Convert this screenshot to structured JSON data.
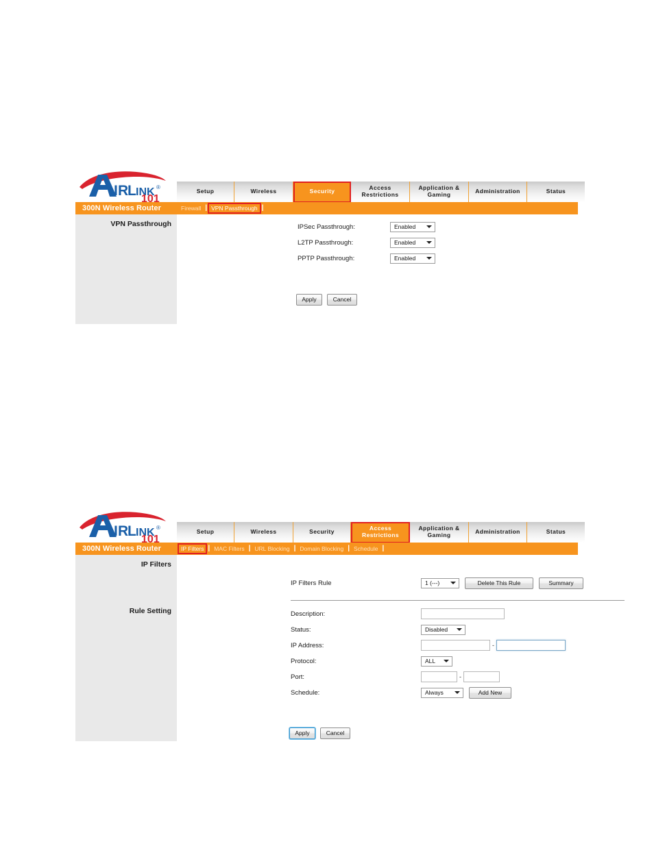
{
  "brand": {
    "name_air": "AIR",
    "name_link": "LINK",
    "registered": "®",
    "number": "101",
    "device_name": "300N Wireless Router"
  },
  "main_tabs": [
    {
      "label": "Setup",
      "lines": [
        "Setup"
      ]
    },
    {
      "label": "Wireless",
      "lines": [
        "Wireless"
      ]
    },
    {
      "label": "Security",
      "lines": [
        "Security"
      ]
    },
    {
      "label": "Access Restrictions",
      "lines": [
        "Access",
        "Restrictions"
      ]
    },
    {
      "label": "Application & Gaming",
      "lines": [
        "Application &",
        "Gaming"
      ]
    },
    {
      "label": "Administration",
      "lines": [
        "Administration"
      ]
    },
    {
      "label": "Status",
      "lines": [
        "Status"
      ]
    }
  ],
  "panel_vpn": {
    "active_main_tab": "Security",
    "subnav": [
      {
        "label": "Firewall",
        "active": false
      },
      {
        "label": "VPN Passthrough",
        "active": true
      }
    ],
    "section_title": "VPN Passthrough",
    "fields": [
      {
        "label": "IPSec Passthrough:",
        "value": "Enabled"
      },
      {
        "label": "L2TP Passthrough:",
        "value": "Enabled"
      },
      {
        "label": "PPTP Passthrough:",
        "value": "Enabled"
      }
    ],
    "buttons": {
      "apply": "Apply",
      "cancel": "Cancel"
    }
  },
  "panel_ipfilters": {
    "active_main_tab": "Access Restrictions",
    "subnav": [
      {
        "label": "IP Filters",
        "active": true
      },
      {
        "label": "MAC Filters",
        "active": false
      },
      {
        "label": "URL Blocking",
        "active": false
      },
      {
        "label": "Domain Blocking",
        "active": false
      },
      {
        "label": "Schedule",
        "active": false
      }
    ],
    "section_title": "IP Filters",
    "section_title_2": "Rule Setting",
    "rule_row": {
      "label": "IP Filters Rule",
      "select_value": "1 (---)",
      "delete_button": "Delete This Rule",
      "summary_button": "Summary"
    },
    "fields": {
      "description_label": "Description:",
      "description_value": "",
      "status_label": "Status:",
      "status_value": "Disabled",
      "ip_address_label": "IP Address:",
      "ip_start_value": "",
      "ip_end_value": "",
      "range_separator": "-",
      "protocol_label": "Protocol:",
      "protocol_value": "ALL",
      "port_label": "Port:",
      "port_start_value": "",
      "port_end_value": "",
      "schedule_label": "Schedule:",
      "schedule_value": "Always",
      "add_new_button": "Add New"
    },
    "buttons": {
      "apply": "Apply",
      "cancel": "Cancel"
    }
  },
  "colors": {
    "orange": "#f7941e",
    "red_highlight": "#e02020",
    "sidebar_gray": "#e9e9e9",
    "logo_blue": "#1a5fa8",
    "logo_red": "#d9232e"
  }
}
